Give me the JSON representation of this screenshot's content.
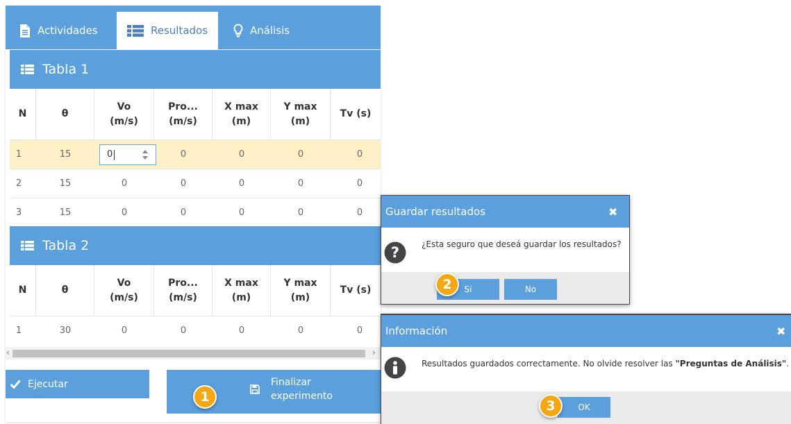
{
  "tabs": [
    {
      "label": "Actividades",
      "icon": "document-icon"
    },
    {
      "label": "Resultados",
      "icon": "list-icon"
    },
    {
      "label": "Análisis",
      "icon": "lightbulb-icon"
    }
  ],
  "tables": [
    {
      "title": "Tabla 1",
      "headers": [
        [
          "N"
        ],
        [
          "θ"
        ],
        [
          "Vo",
          "(m/s)"
        ],
        [
          "Pro...",
          "(m/s)"
        ],
        [
          "X max",
          "(m)"
        ],
        [
          "Y max",
          "(m)"
        ],
        [
          "Tv (s)"
        ]
      ],
      "rows": [
        [
          "1",
          "15",
          "0",
          "0",
          "0",
          "0",
          "0"
        ],
        [
          "2",
          "15",
          "0",
          "0",
          "0",
          "0",
          "0"
        ],
        [
          "3",
          "15",
          "0",
          "0",
          "0",
          "0",
          "0"
        ]
      ]
    },
    {
      "title": "Tabla 2",
      "headers": [
        [
          "N"
        ],
        [
          "θ"
        ],
        [
          "Vo",
          "(m/s)"
        ],
        [
          "Pro...",
          "(m/s)"
        ],
        [
          "X max",
          "(m)"
        ],
        [
          "Y max",
          "(m)"
        ],
        [
          "Tv (s)"
        ]
      ],
      "rows": [
        [
          "1",
          "30",
          "0",
          "0",
          "0",
          "0",
          "0"
        ]
      ]
    }
  ],
  "buttons": {
    "execute": "Ejecutar",
    "finish_line1": "Finalizar",
    "finish_line2": "experimento"
  },
  "dialog_save": {
    "title": "Guardar resultados",
    "message": "¿Esta seguro que deseá guardar los resultados?",
    "yes": "Si",
    "no": "No"
  },
  "dialog_info": {
    "title": "Información",
    "message_prefix": "Resultados guardados correctamente. No olvide resolver las ",
    "message_bold": "\"Preguntas de Análisis\"",
    "message_suffix": ".",
    "ok": "OK"
  },
  "steps": [
    "1",
    "2",
    "3"
  ],
  "colors": {
    "accent": "#5b9fdd",
    "badge": "#f3a712",
    "selected_row": "#fdf0c7"
  }
}
